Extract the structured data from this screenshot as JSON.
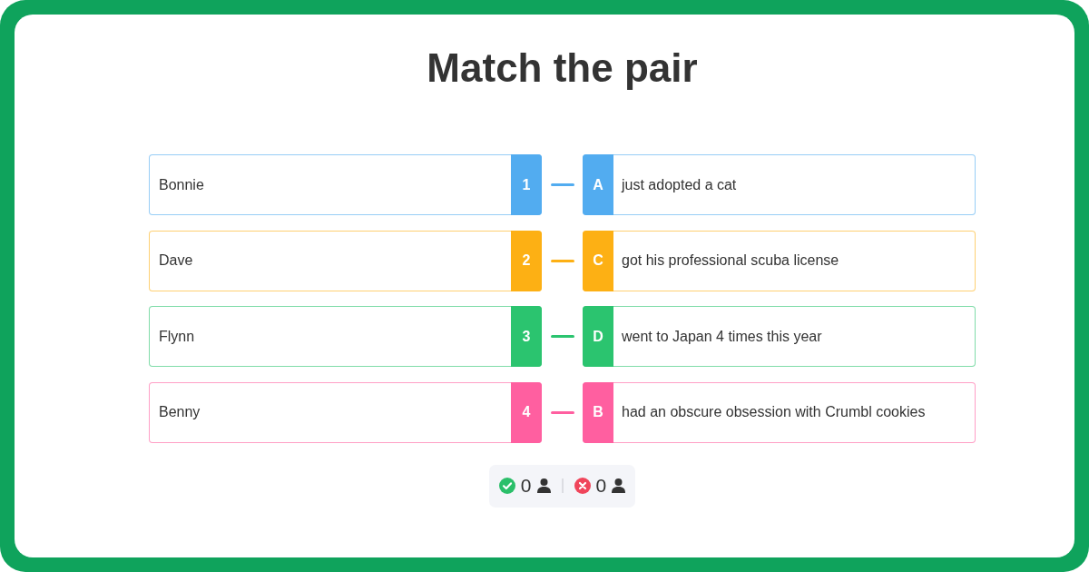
{
  "title": "Match the pair",
  "pairs": [
    {
      "number": "1",
      "name": "Bonnie",
      "letter": "A",
      "statement": "just adopted a cat",
      "color": "#52acf0"
    },
    {
      "number": "2",
      "name": "Dave",
      "letter": "C",
      "statement": "got his professional scuba license",
      "color": "#fdb014"
    },
    {
      "number": "3",
      "name": "Flynn",
      "letter": "D",
      "statement": "went to Japan 4 times this year",
      "color": "#2bc46f"
    },
    {
      "number": "4",
      "name": "Benny",
      "letter": "B",
      "statement": "had an obscure obsession with Crumbl cookies",
      "color": "#ff5fa0"
    }
  ],
  "score": {
    "correct": "0",
    "incorrect": "0"
  }
}
